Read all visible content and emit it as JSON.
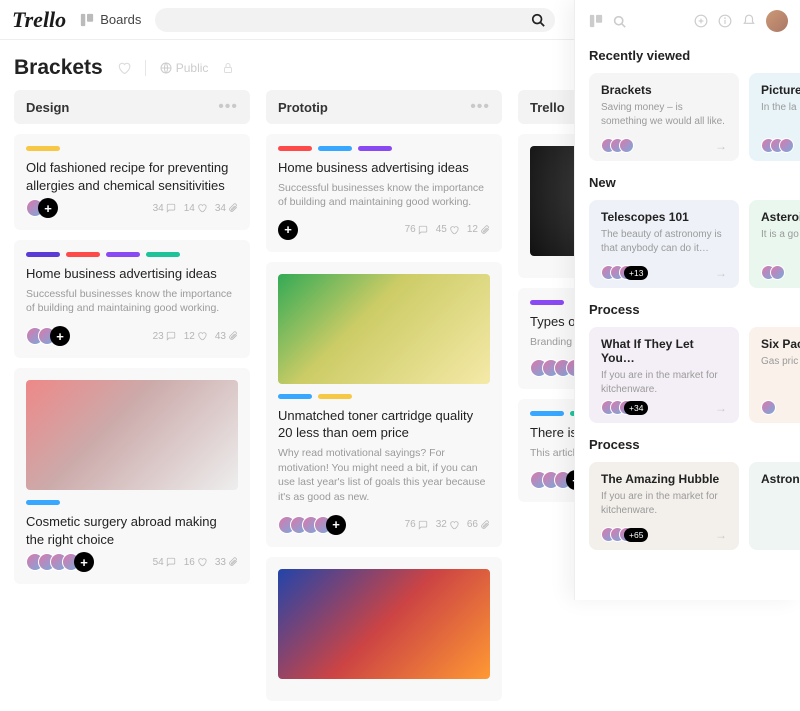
{
  "nav": {
    "boards_label": "Boards"
  },
  "board": {
    "title": "Brackets",
    "visibility": "Public"
  },
  "lists": [
    {
      "title": "Design",
      "cards": [
        {
          "labels": [
            "#f7c846"
          ],
          "title": "Old fashioned recipe for preventing allergies and chemical sensitivities",
          "avatars": 1,
          "plus": true,
          "metrics": {
            "comments": 34,
            "likes": 14,
            "attach": 34
          }
        },
        {
          "labels": [
            "#5b3bd6",
            "#ff4a4a",
            "#8a4af3",
            "#1fc39a"
          ],
          "title": "Home business advertising ideas",
          "desc": "Successful businesses know the importance of building and maintaining good working.",
          "avatars": 2,
          "plus": true,
          "metrics": {
            "comments": 23,
            "likes": 12,
            "attach": 43
          }
        },
        {
          "image": "hand",
          "labels": [
            "#37a7ff"
          ],
          "title": "Cosmetic surgery abroad making the right choice",
          "avatars": 4,
          "plus": true,
          "metrics": {
            "comments": 54,
            "likes": 16,
            "attach": 33
          }
        }
      ]
    },
    {
      "title": "Prototip",
      "cards": [
        {
          "labels": [
            "#ff4a4a",
            "#37a7ff",
            "#8a4af3"
          ],
          "title": "Home business advertising ideas",
          "desc": "Successful businesses know the importance of building and maintaining good working.",
          "avatars": 0,
          "plus": true,
          "metrics": {
            "comments": 76,
            "likes": 45,
            "attach": 12
          }
        },
        {
          "image": "zombie",
          "labels": [
            "#37a7ff",
            "#f7c846"
          ],
          "title": "Unmatched toner cartridge quality 20 less than oem price",
          "desc": "Why read motivational sayings? For motivation! You might need a bit, if you can use last year's list of goals this year because it's as good as new.",
          "avatars": 4,
          "plus": true,
          "metrics": {
            "comments": 76,
            "likes": 32,
            "attach": 66
          }
        },
        {
          "image": "shapes"
        }
      ]
    },
    {
      "title": "Trello",
      "cards": [
        {
          "image": "dark"
        },
        {
          "labels": [
            "#8a4af3"
          ],
          "title": "Types of p",
          "desc": "Branding is\nappeal (or the\nas given in m",
          "avatars": 4
        },
        {
          "labels": [
            "#37a7ff",
            "#1fc39a"
          ],
          "title": "There is no",
          "desc": "This article is\nyou find the b",
          "avatars": 3,
          "plus": true
        }
      ]
    }
  ],
  "panel": {
    "sections": [
      {
        "title": "Recently viewed",
        "items": [
          {
            "title": "Brackets",
            "desc": "Saving money – is something we would all like.",
            "bg": "#f5f5f5",
            "avatars": 3,
            "arrow": true
          },
          {
            "title": "Picture",
            "desc": "In the la\nFTA sate",
            "bg": "#e9f4f9",
            "avatars": 3
          }
        ]
      },
      {
        "title": "New",
        "items": [
          {
            "title": "Telescopes 101",
            "desc": "The beauty of astronomy is that anybody can do it…",
            "bg": "#eef2f8",
            "avatars": 3,
            "badge": "+13",
            "arrow": true
          },
          {
            "title": "Asteroi",
            "desc": "It is a go\nPC as an",
            "bg": "#eaf7ef",
            "avatars": 2
          }
        ]
      },
      {
        "title": "Process",
        "items": [
          {
            "title": "What If They Let You…",
            "desc": "If you are in the market for kitchenware.",
            "bg": "#f4eff6",
            "avatars": 3,
            "badge": "+34",
            "arrow": true
          },
          {
            "title": "Six Pac",
            "desc": "Gas pric",
            "bg": "#faf1ea",
            "avatars": 1
          }
        ]
      },
      {
        "title": "Process",
        "items": [
          {
            "title": "The Amazing Hubble",
            "desc": "If you are in the market for kitchenware.",
            "bg": "#f3f0ec",
            "avatars": 3,
            "badge": "+65",
            "arrow": true
          },
          {
            "title": "Astrono",
            "desc": "",
            "bg": "#eef5f3",
            "avatars": 0
          }
        ]
      }
    ]
  }
}
